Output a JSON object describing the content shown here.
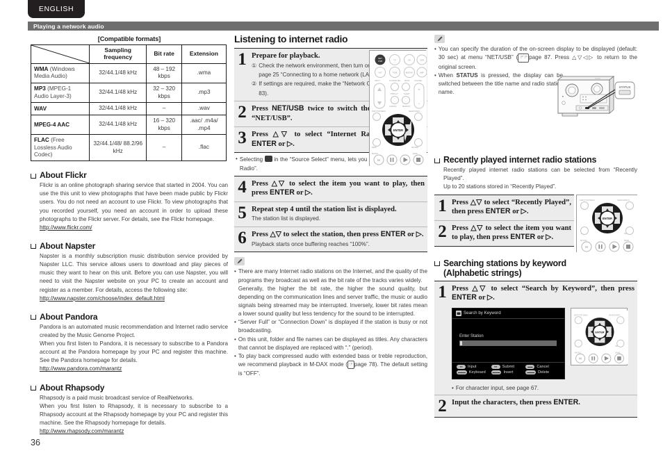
{
  "header": {
    "language_tab": "ENGLISH",
    "section_bar": "Playing a network audio"
  },
  "page_number": "36",
  "left_column": {
    "table": {
      "caption": "[Compatible formats]",
      "columns": [
        "",
        "Sampling frequency",
        "Bit rate",
        "Extension"
      ],
      "rows": [
        {
          "format_bold": "WMA",
          "format_rest": " (Windows Media Audio)",
          "sampling": "32/44.1/48 kHz",
          "bitrate": "48 – 192 kbps",
          "extension": ".wma"
        },
        {
          "format_bold": "MP3",
          "format_rest": " (MPEG-1 Audio Layer-3)",
          "sampling": "32/44.1/48 kHz",
          "bitrate": "32 – 320 kbps",
          "extension": ".mp3"
        },
        {
          "format_bold": "WAV",
          "format_rest": "",
          "sampling": "32/44.1/48 kHz",
          "bitrate": "–",
          "extension": ".wav"
        },
        {
          "format_bold": "MPEG-4 AAC",
          "format_rest": "",
          "sampling": "32/44.1/48 kHz",
          "bitrate": "16 – 320 kbps",
          "extension": ".aac/ .m4a/ .mp4"
        },
        {
          "format_bold": "FLAC",
          "format_rest": " (Free Lossless Audio Codec)",
          "sampling": "32/44.1/48/ 88.2/96 kHz",
          "bitrate": "–",
          "extension": ".flac"
        }
      ]
    },
    "about_flickr": {
      "heading": "About Flickr",
      "body": "Flickr is an online photograph sharing service that started in 2004. You can use the this unit to view photographs that have been made public by Flickr users. You do not need an account to use Flickr. To view photographs that you recorded yourself, you need an account in order to upload these photographs to the Flickr server. For details, see the Flickr homepage.",
      "link": "http://www.flickr.com/"
    },
    "about_napster": {
      "heading": "About Napster",
      "body": "Napster is a monthly subscription music distribution service provided by Napster LLC. This service allows users to download and play pieces of music they want to hear on this unit. Before you can use Napster, you will need to visit the Napster website on your PC to create an account and register as a member. For details, access the following site:",
      "link": "http://www.napster.com/choose/index_default.html"
    },
    "about_pandora": {
      "heading": "About Pandora",
      "body1": "Pandora is an automated music recommendation and Internet radio service created by the Music Genome Project.",
      "body2": "When you first listen to Pandora, it is necessary to subscribe to a Pandora account at the Pandora homepage by your PC and register this machine. See the Pandora homepage for details.",
      "link": "http://www.pandora.com/marantz"
    },
    "about_rhapsody": {
      "heading": "About Rhapsody",
      "body1": "Rhapsody is a paid music broadcast service of RealNetworks.",
      "body2": "When you first listen to Rhapsody, it is necessary to subscribe to a Rhapsody account at the Rhapsody homepage by your PC and register this machine. See the Rhapsody homepage for details.",
      "link": "http://www.rhapsody.com/marantz"
    }
  },
  "mid_column": {
    "title": "Listening to internet radio",
    "step1": {
      "num": "1",
      "title": "Prepare for playback.",
      "item1_num": "①",
      "item1_a": "Check the network environment, then turn on this unit's power (",
      "item1_page": "page 25",
      "item1_b": " “Connecting to a home network (LAN)”).",
      "item2_num": "②",
      "item2_a": "If settings are required, make the “Network Connecting” (",
      "item2_page": "page 83",
      "item2_b": ")."
    },
    "step2": {
      "num": "2",
      "title_a": "Press ",
      "title_b": "NET/USB",
      "title_c": " twice to switch the input source to “NET/USB”."
    },
    "step3": {
      "num": "3",
      "title_a": "Press ",
      "title_b": "△▽",
      "title_c": " to select “Internet Radio”, then press ",
      "title_d": "ENTER",
      "title_e": " or ▷."
    },
    "note_source_select_a": "Selecting ",
    "note_source_select_b": " in the “Source Select” menu, lets you directly select “Internet Radio”.",
    "step4": {
      "num": "4",
      "title_a": "Press ",
      "title_b": "△▽",
      "title_c": " to select the item you want to play, then press ",
      "title_d": "ENTER",
      "title_e": " or ▷."
    },
    "step5": {
      "num": "5",
      "title": "Repeat step 4 until the station list is displayed.",
      "sub": "The station list is displayed."
    },
    "step6": {
      "num": "6",
      "title_a": "Press ",
      "title_b": "△▽",
      "title_c": " to select the station, then press ",
      "title_d": "ENTER",
      "title_e": " or ▷.",
      "sub": "Playback starts once buffering reaches “100%”."
    },
    "notes": {
      "n1_p1": "There are many Internet radio stations on the Internet, and the quality of the programs they broadcast as well as the bit rate of the tracks varies widely.",
      "n1_p2": "Generally, the higher the bit rate, the higher the sound quality, but depending on the communication lines and server traffic, the music or audio signals being streamed may be interrupted. Inversely, lower bit rates mean a lower sound quality but less tendency for the sound to be interrupted.",
      "n2": "“Server Full” or “Connection Down” is displayed if the station is busy or not broadcasting.",
      "n3": "On this unit, folder and file names can be displayed as titles. Any characters that cannot be displayed are replaced with “.” (period).",
      "n4_a": "To play back compressed audio with extended bass or treble reproduction, we recommend playback in M-DAX mode (",
      "n4_page": "page 78",
      "n4_b": "). The default setting is “OFF”."
    }
  },
  "right_column": {
    "notes_top": {
      "n1_a": "You can specify the duration of the on-screen display to be displayed (default: 30 sec) at menu “NET/USB” (",
      "n1_page": "page 87",
      "n1_b": ". Press △▽◁▷ to return to the original screen.",
      "n2_a": "When ",
      "n2_b": "STATUS",
      "n2_c": " is pressed, the display can be switched between the title name and radio station name."
    },
    "receiver_callout": "STATUS",
    "recently_played": {
      "heading": "Recently played internet radio stations",
      "body1": "Recently played internet radio stations can be selected from “Recently Played”.",
      "body2": "Up to 20 stations stored in “Recently Played”.",
      "step1": {
        "num": "1",
        "title_a": "Press ",
        "title_b": "△▽",
        "title_c": " to select “Recently Played”, then press ",
        "title_d": "ENTER",
        "title_e": " or ▷."
      },
      "step2": {
        "num": "2",
        "title_a": "Press ",
        "title_b": "△▽",
        "title_c": " to select the item you want to play, then press ",
        "title_d": "ENTER",
        "title_e": " or ▷."
      }
    },
    "search_by_keyword": {
      "heading_line1": "Searching stations by keyword",
      "heading_line2": "(Alphabetic strings)",
      "step1": {
        "num": "1",
        "title_a": "Press ",
        "title_b": "△▽",
        "title_c": " to select “Search by Keyword”, then press ",
        "title_d": "ENTER",
        "title_e": " or ▷."
      },
      "osd": {
        "title": "Search by Keyword",
        "field_label": "Enter Station",
        "field_value": "",
        "keys": [
          {
            "cap": "●●",
            "label": "Input"
          },
          {
            "cap": "●●",
            "label": "Submit"
          },
          {
            "cap": "▬▬",
            "label": "Cancel"
          },
          {
            "cap": "▬▬▬",
            "label": "Keyboard"
          },
          {
            "cap": "▬▬▬",
            "label": "Insert"
          },
          {
            "cap": "▬▬▬",
            "label": "Delete"
          }
        ]
      },
      "char_input_note": "For character input, see page 67.",
      "step2": {
        "num": "2",
        "title_a": "Input the characters, then press ",
        "title_b": "ENTER",
        "title_c": "."
      }
    }
  },
  "remote_full": {
    "top_buttons": [
      "NET/USB",
      "TV",
      "CD",
      "CDR"
    ],
    "row2_buttons": [
      "SAT/C",
      "TUNE",
      "BD/DVD",
      "AMP"
    ],
    "labels": [
      "INPUT",
      "SOURCE SEL",
      "MUTE",
      "VOLUME",
      "DISPLAY",
      "SLEEP",
      "CH/DISP",
      "MEMORY",
      "SHIFT/TOP MENU",
      "SEARCH/INFO",
      "MENU",
      "RETURN",
      "MACRO",
      "BAND",
      "ENTER"
    ]
  }
}
